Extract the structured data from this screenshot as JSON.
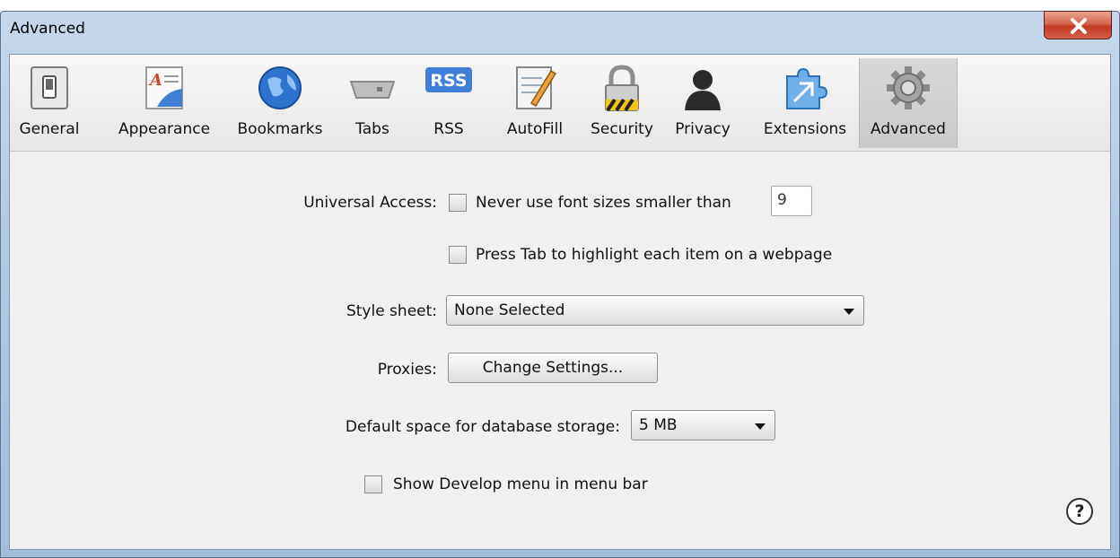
{
  "window": {
    "title": "Advanced"
  },
  "toolbar": {
    "items": [
      {
        "label": "General",
        "icon": "general-switch-icon"
      },
      {
        "label": "Appearance",
        "icon": "appearance-icon"
      },
      {
        "label": "Bookmarks",
        "icon": "globe-icon"
      },
      {
        "label": "Tabs",
        "icon": "tabs-icon"
      },
      {
        "label": "RSS",
        "icon": "rss-icon",
        "icon_text": "RSS"
      },
      {
        "label": "AutoFill",
        "icon": "autofill-icon"
      },
      {
        "label": "Security",
        "icon": "lock-icon"
      },
      {
        "label": "Privacy",
        "icon": "person-icon"
      },
      {
        "label": "Extensions",
        "icon": "extensions-icon"
      },
      {
        "label": "Advanced",
        "icon": "gear-icon"
      }
    ],
    "selected": "Advanced"
  },
  "universal_access": {
    "label": "Universal Access:",
    "min_font": {
      "text": "Never use font sizes smaller than",
      "checked": false,
      "value": "9"
    },
    "tab_highlight": {
      "text": "Press Tab to highlight each item on a webpage",
      "checked": false
    }
  },
  "style_sheet": {
    "label": "Style sheet:",
    "value": "None Selected"
  },
  "proxies": {
    "label": "Proxies:",
    "button": "Change Settings..."
  },
  "database": {
    "label": "Default space for database storage:",
    "value": "5 MB"
  },
  "develop_menu": {
    "text": "Show Develop menu in menu bar",
    "checked": false
  },
  "help": {
    "label": "?"
  },
  "colors": {
    "accent": "#3f7fd6",
    "selected_tab": "#cbcbcb",
    "close_button": "#c8452b"
  }
}
